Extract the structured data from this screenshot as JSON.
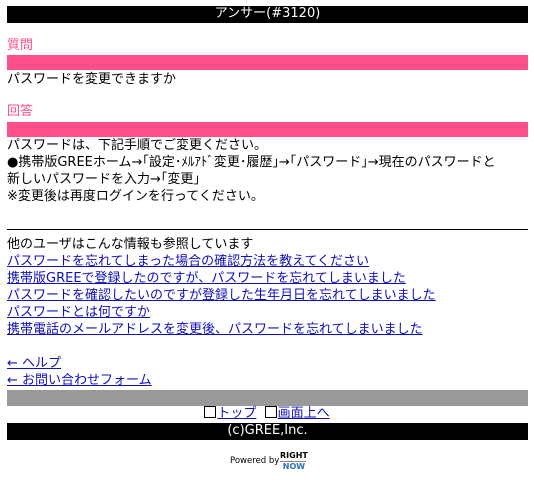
{
  "header": {
    "title": "アンサー(#3120)"
  },
  "question": {
    "label": "質問",
    "text": "パスワードを変更できますか"
  },
  "answer": {
    "label": "回答",
    "lines": [
      "パスワードは、下記手順でご変更ください。",
      "●携帯版GREEホーム→｢設定･ﾒﾙｱﾄﾞ変更･履歴｣→｢パスワード｣→現在のパスワードと",
      "新しいパスワードを入力→｢変更｣",
      "※変更後は再度ログインを行ってください。"
    ]
  },
  "related": {
    "heading": "他のユーザはこんな情報も参照しています",
    "links": [
      "パスワードを忘れてしまった場合の確認方法を教えてください",
      "携帯版GREEで登録したのですが、パスワードを忘れてしまいました",
      "パスワードを確認したいのですが登録した生年月日を忘れてしまいました",
      "パスワードとは何ですか",
      "携帯電話のメールアドレスを変更後、パスワードを忘れてしまいました"
    ]
  },
  "nav": {
    "help": "← ヘルプ",
    "contact": "← お問い合わせフォーム",
    "top": "トップ",
    "page_top": "画面上へ"
  },
  "footer": {
    "copyright": "(c)GREE,Inc.",
    "powered_by": "Powered by",
    "brand_line1": "RIGHT",
    "brand_line2": "NOW"
  }
}
